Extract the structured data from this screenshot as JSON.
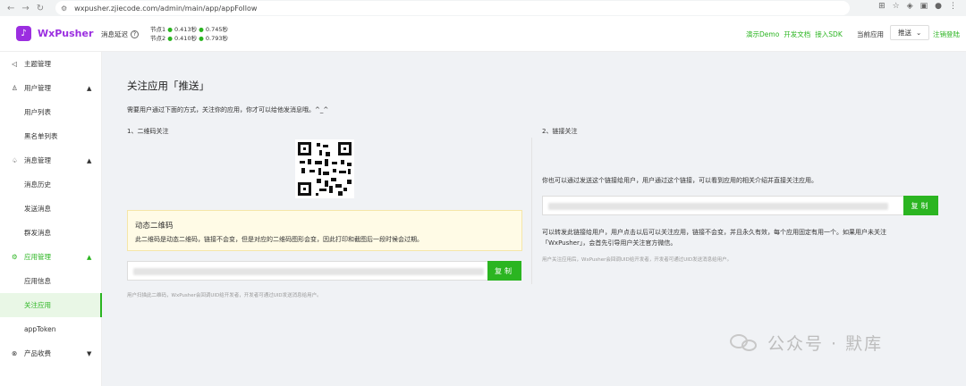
{
  "browser": {
    "url": "wxpusher.zjiecode.com/admin/main/app/appFollow",
    "back_glyph": "←",
    "forward_glyph": "→",
    "reload_glyph": "↻"
  },
  "header": {
    "logo_text": "WxPusher",
    "latency_label": "消息延迟",
    "nodes": [
      {
        "label": "节点1",
        "value1": "0.413秒",
        "value2": "0.745秒"
      },
      {
        "label": "节点2",
        "value1": "0.410秒",
        "value2": "0.793秒"
      }
    ],
    "links": [
      "演示Demo",
      "开发文档",
      "接入SDK"
    ],
    "current_app_label": "当前应用",
    "current_app_value": "推送",
    "logout_label": "注销登陆",
    "accent_color": "#2bb521"
  },
  "sidebar": {
    "items": [
      {
        "label": "主题管理",
        "icon": "topic-icon"
      },
      {
        "label": "用户管理",
        "icon": "user-icon",
        "chevron": "▲"
      },
      {
        "label": "用户列表"
      },
      {
        "label": "黑名单列表"
      },
      {
        "label": "消息管理",
        "icon": "bell-icon",
        "chevron": "▲"
      },
      {
        "label": "消息历史"
      },
      {
        "label": "发送消息"
      },
      {
        "label": "群发消息"
      },
      {
        "label": "应用管理",
        "icon": "app-icon",
        "chevron": "▲"
      },
      {
        "label": "应用信息"
      },
      {
        "label": "关注应用"
      },
      {
        "label": "appToken"
      },
      {
        "label": "产品收费",
        "icon": "fee-icon",
        "chevron": "▼"
      }
    ]
  },
  "main": {
    "title": "关注应用「推送」",
    "description": "需要用户通过下面的方式，关注你的应用，你才可以给他发消息哦。^_^",
    "qr_section_title": "1、二维码关注",
    "link_section_title": "2、链接关注",
    "notice_title": "动态二维码",
    "notice_body": "此二维码是动态二维码，链接不会变，但是对应的二维码图形会变，因此打印和截图后一段时候会过期。",
    "copy_label": "复制",
    "qr_hint": "用户扫描此二维码，WxPusher会回调UID给开发者，开发者可通过UID发送消息给用户。",
    "link_description": "你也可以通过发送这个链接给用户，用户通过这个链接，可以看到应用的相关介绍并直接关注应用。",
    "link_note_line1": "可以转发此链接给用户，用户点击以后可以关注应用，链接不会变，并且永久有效，每个应用固定有用一个。如果用户未关注",
    "link_note_line2": "「WxPusher」，会首先引导用户关注官方微信。",
    "link_hint": "用户关注应用后，WxPusher会回调UID给开发者，开发者可通过UID发送消息给用户。"
  },
  "watermark": {
    "text": "公众号 · 默库"
  }
}
